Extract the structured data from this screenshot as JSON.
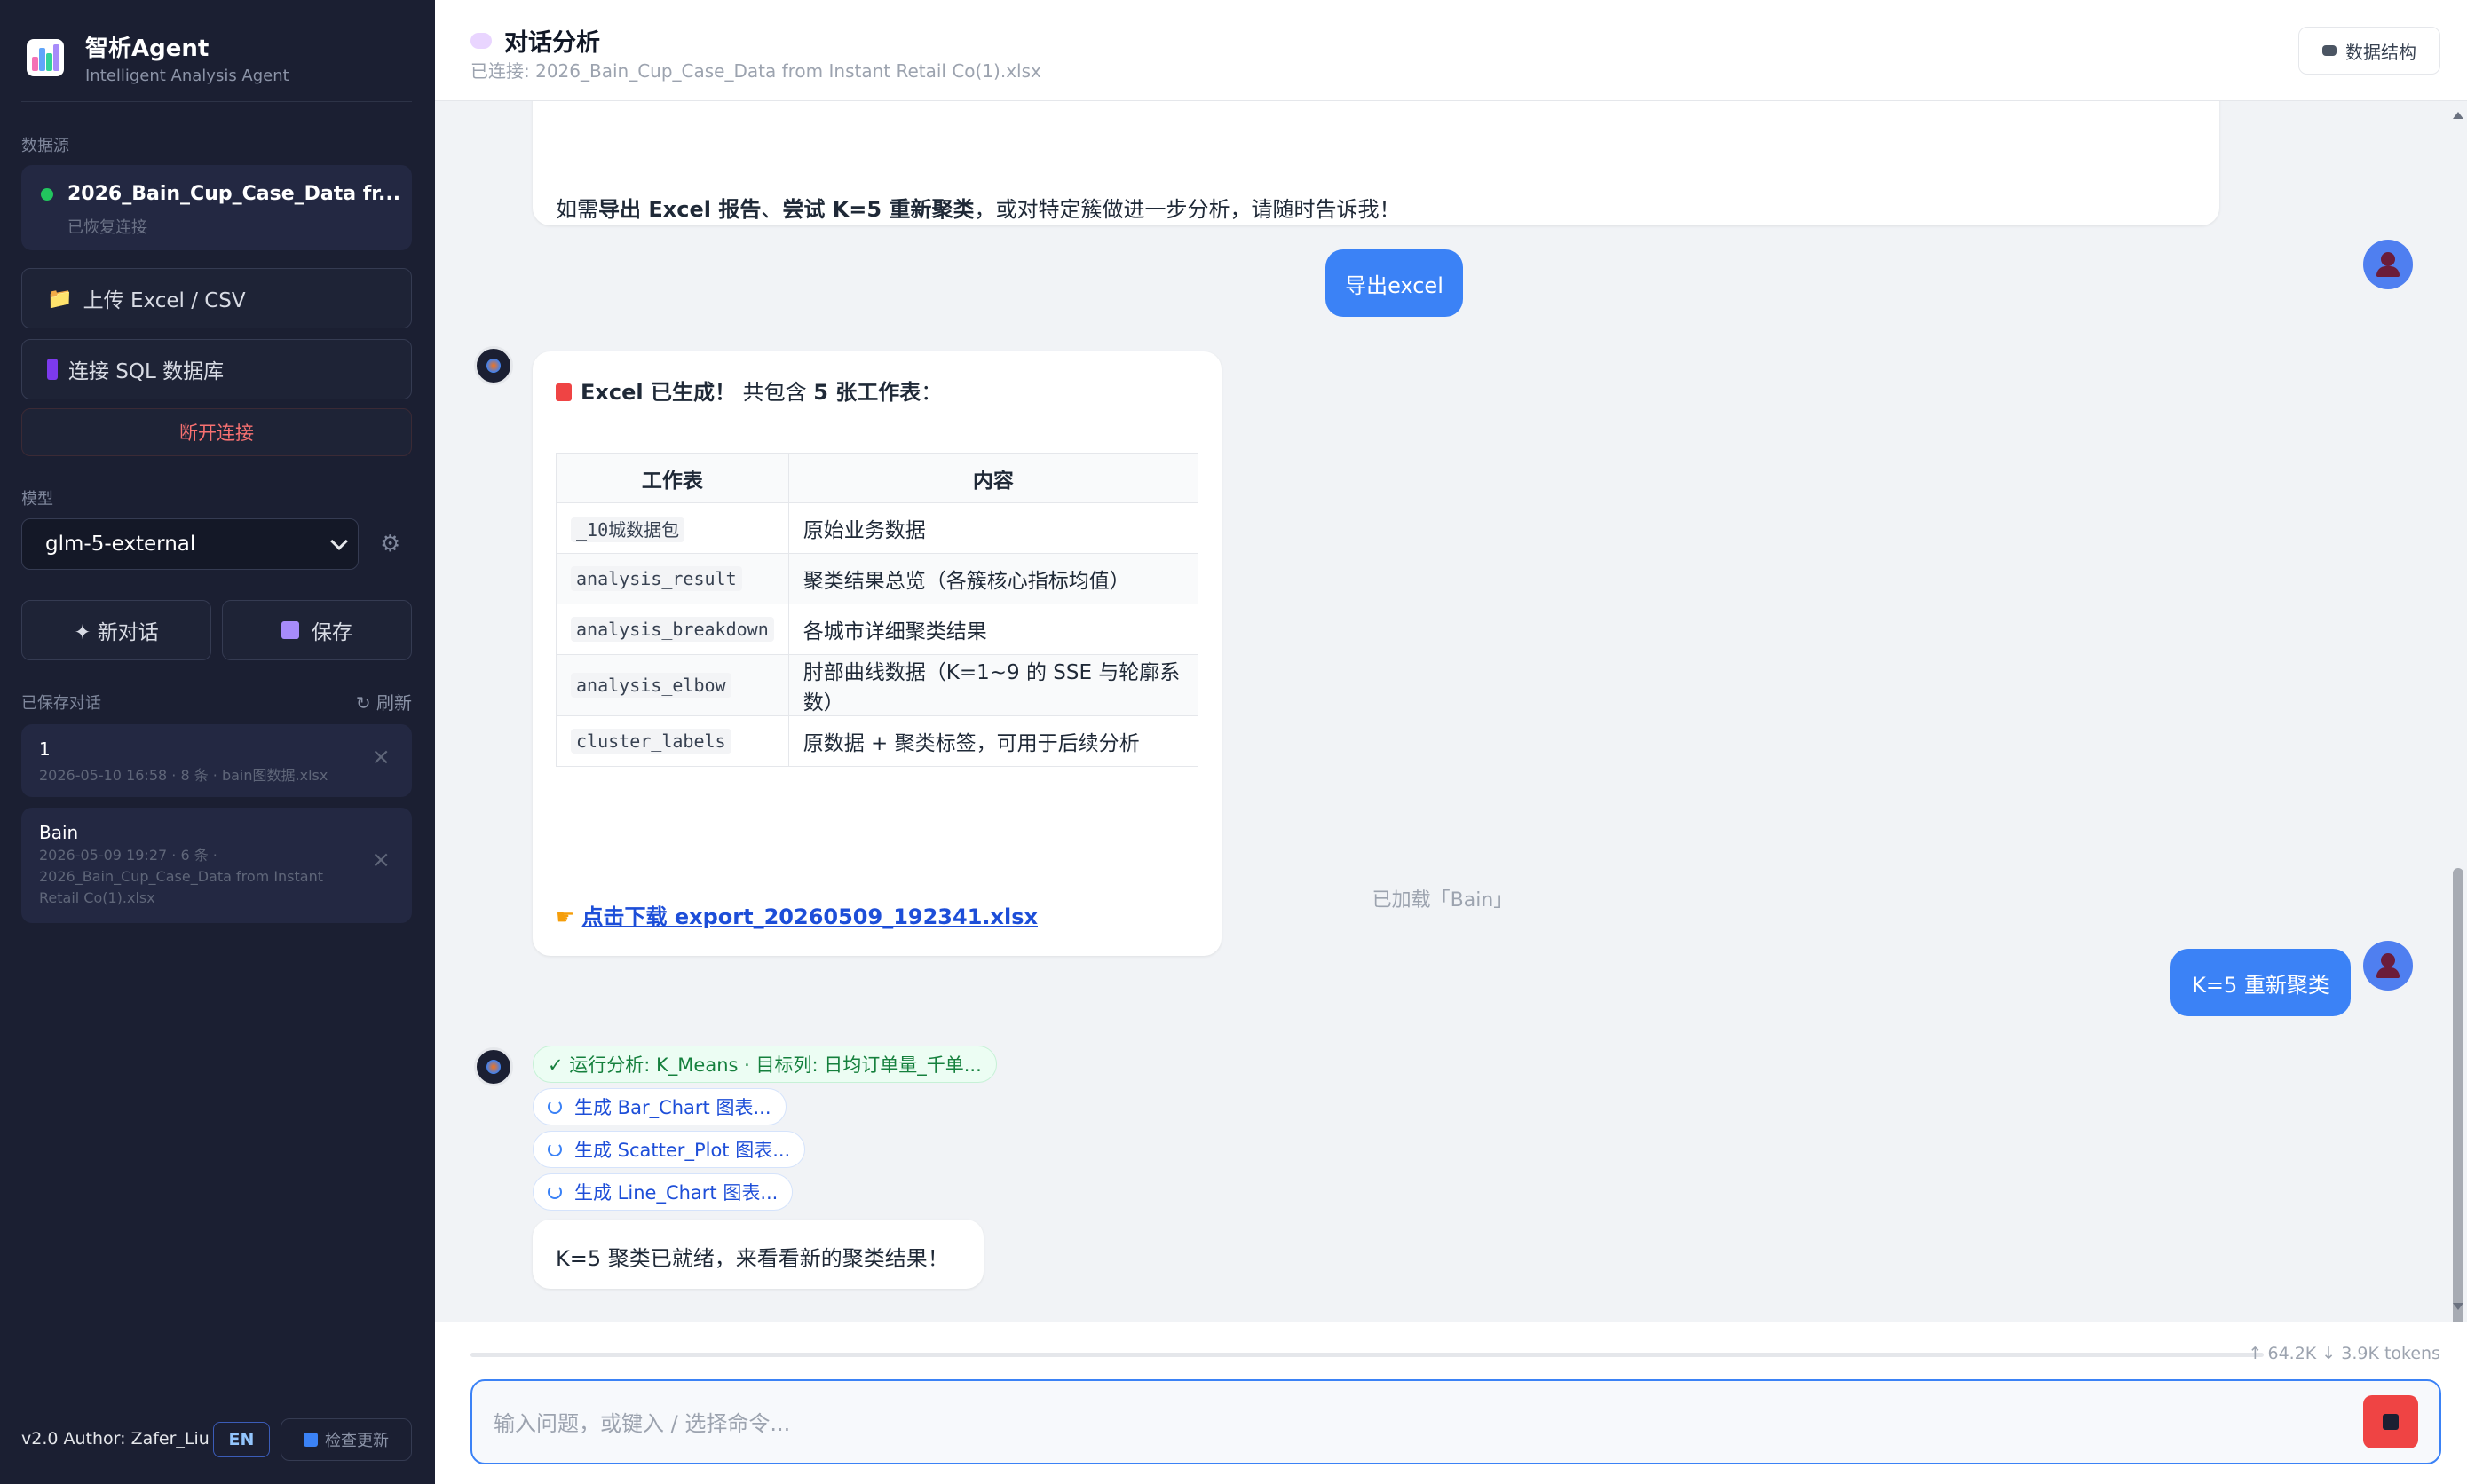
{
  "brand": {
    "title": "智析Agent",
    "subtitle": "Intelligent Analysis Agent",
    "icon": "bar-chart-logo"
  },
  "sidebar": {
    "datasource_label": "数据源",
    "datasource": {
      "name": "2026_Bain_Cup_Case_Data fr...",
      "status": "已恢复连接",
      "status_color": "#22c55e"
    },
    "upload_button": "上传 Excel / CSV",
    "sql_button": "连接 SQL 数据库",
    "disconnect_button": "断开连接",
    "model_label": "模型",
    "model_value": "glm-5-external",
    "new_chat_button": "✦ 新对话",
    "save_button": "保存",
    "saved_label": "已保存对话",
    "refresh_label": "↻ 刷新",
    "conversations": [
      {
        "title": "1",
        "meta": "2026-05-10 16:58 · 8 条 · bain图数据.xlsx"
      },
      {
        "title": "Bain",
        "meta": "2026-05-09 19:27 · 6 条 · 2026_Bain_Cup_Case_Data from Instant Retail Co(1).xlsx"
      }
    ],
    "author": "v2.0 Author: Zafer_Liu",
    "lang_button": "EN",
    "update_button": "检查更新"
  },
  "header": {
    "title": "对话分析",
    "connection": "已连接: 2026_Bain_Cup_Case_Data from Instant Retail Co(1).xlsx",
    "schema_button": "数据结构"
  },
  "chat": {
    "msg1": {
      "pre": "如需",
      "b1": "导出 Excel 报告",
      "sep": "、",
      "b2": "尝试 K=5 重新聚类",
      "post": "，或对特定簇做进一步分析，请随时告诉我！"
    },
    "user1": "导出excel",
    "excel_msg": {
      "head_bold": "Excel 已生成！",
      "head_mid": " 共包含 ",
      "head_bold2": "5 张工作表",
      "head_end": "：",
      "table_headers": [
        "工作表",
        "内容"
      ],
      "rows": [
        {
          "sheet": "_10城数据包",
          "content": "原始业务数据"
        },
        {
          "sheet": "analysis_result",
          "content": "聚类结果总览（各簇核心指标均值）"
        },
        {
          "sheet": "analysis_breakdown",
          "content": "各城市详细聚类结果"
        },
        {
          "sheet": "analysis_elbow",
          "content": "肘部曲线数据（K=1~9 的 SSE 与轮廓系数）"
        },
        {
          "sheet": "cluster_labels",
          "content": "原数据 + 聚类标签，可用于后续分析"
        }
      ],
      "download_link": "点击下载 export_20260509_192341.xlsx"
    },
    "system_note": "已加载「Bain」",
    "user2": "K=5 重新聚类",
    "tools": [
      {
        "label": "✓ 运行分析: K_Means · 目标列: 日均订单量_千单..."
      },
      {
        "label": "生成 Bar_Chart 图表..."
      },
      {
        "label": "生成 Scatter_Plot 图表..."
      },
      {
        "label": "生成 Line_Chart 图表..."
      }
    ],
    "final_msg": "K=5 聚类已就绪，来看看新的聚类结果！"
  },
  "footer": {
    "tokens": "↑ 64.2K ↓ 3.9K tokens",
    "input_placeholder": "输入问题，或键入 / 选择命令..."
  },
  "colors": {
    "accent": "#3b82f6",
    "sidebar_bg": "#1b1f32",
    "danger": "#ef4444"
  }
}
